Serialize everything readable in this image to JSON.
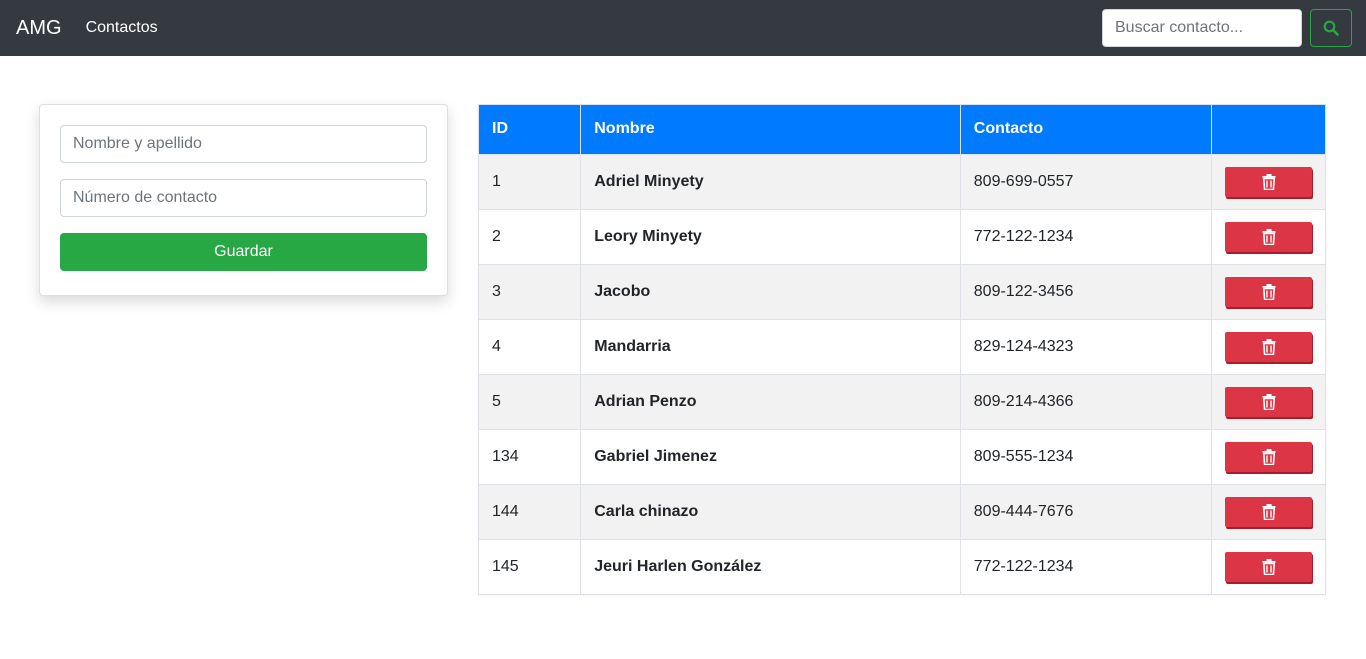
{
  "navbar": {
    "brand": "AMG",
    "nav_link": "Contactos",
    "search_placeholder": "Buscar contacto..."
  },
  "form": {
    "name_placeholder": "Nombre y apellido",
    "phone_placeholder": "Número de contacto",
    "save_label": "Guardar"
  },
  "table": {
    "headers": [
      "ID",
      "Nombre",
      "Contacto",
      ""
    ],
    "rows": [
      {
        "id": "1",
        "name": "Adriel Minyety",
        "contact": "809-699-0557"
      },
      {
        "id": "2",
        "name": "Leory Minyety",
        "contact": "772-122-1234"
      },
      {
        "id": "3",
        "name": "Jacobo",
        "contact": "809-122-3456"
      },
      {
        "id": "4",
        "name": "Mandarria",
        "contact": "829-124-4323"
      },
      {
        "id": "5",
        "name": "Adrian Penzo",
        "contact": "809-214-4366"
      },
      {
        "id": "134",
        "name": "Gabriel Jimenez",
        "contact": "809-555-1234"
      },
      {
        "id": "144",
        "name": "Carla chinazo",
        "contact": "809-444-7676"
      },
      {
        "id": "145",
        "name": "Jeuri Harlen González",
        "contact": "772-122-1234"
      }
    ],
    "delete_icon": "trash-icon"
  },
  "colors": {
    "navbar": "#343a40",
    "primary": "#007bff",
    "success": "#28a745",
    "danger": "#dc3545"
  }
}
